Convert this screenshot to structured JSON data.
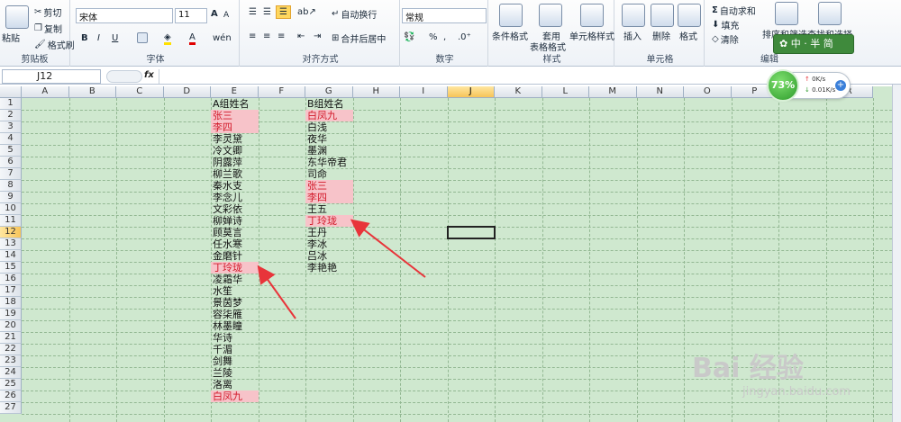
{
  "ribbon": {
    "clipboard": {
      "paste": "粘贴",
      "cut": "剪切",
      "copy": "复制",
      "format_painter": "格式刷",
      "label": "剪贴板"
    },
    "font": {
      "name": "宋体",
      "size": "11",
      "bold": "B",
      "italic": "I",
      "underline": "U",
      "grow": "A",
      "shrink": "A",
      "phonetic": "wén",
      "label": "字体"
    },
    "alignment": {
      "wrap": "自动换行",
      "merge": "合并后居中",
      "label": "对齐方式"
    },
    "number": {
      "format": "常规",
      "percent": "%",
      "comma": ",",
      "label": "数字"
    },
    "styles": {
      "conditional": "条件格式",
      "table_line1": "套用",
      "table_line2": "表格格式",
      "cell_styles": "单元格样式",
      "label": "样式"
    },
    "cells": {
      "insert": "插入",
      "delete": "删除",
      "format": "格式",
      "label": "单元格"
    },
    "editing": {
      "autosum": "自动求和",
      "fill": "填充",
      "clear": "清除",
      "sort": "排序和筛选",
      "find": "查找和选择",
      "label": "编辑"
    }
  },
  "formula_bar": {
    "name_box": "J12",
    "fx": "fx"
  },
  "widget": {
    "percent": "73%",
    "up": "0K/s",
    "down": "0.01K/s",
    "ime": "中 · 半 简"
  },
  "columns": [
    "A",
    "B",
    "C",
    "D",
    "E",
    "F",
    "G",
    "H",
    "I",
    "J",
    "K",
    "L",
    "M",
    "N",
    "O",
    "P",
    "Q",
    "R"
  ],
  "rows": [
    "1",
    "2",
    "3",
    "4",
    "5",
    "6",
    "7",
    "8",
    "9",
    "10",
    "11",
    "12",
    "13",
    "14",
    "15",
    "16",
    "17",
    "18",
    "19",
    "20",
    "21",
    "22",
    "23",
    "24",
    "25",
    "26",
    "27"
  ],
  "selected_column": "J",
  "selected_row": "12",
  "group_a": {
    "header": "A组姓名",
    "names": [
      "张三",
      "李四",
      "李灵黛",
      "冷文卿",
      "阴露萍",
      "柳兰歌",
      "秦水支",
      "李念儿",
      "文彩依",
      "柳婵诗",
      "顾莫言",
      "任水寒",
      "金磨针",
      "丁玲珑",
      "凌霜华",
      "水笙",
      "景茵梦",
      "容柒雁",
      "林墨瞳",
      "华诗",
      "千湄",
      "剑舞",
      "兰陵",
      "洛离",
      "白凤九"
    ],
    "highlighted": [
      0,
      1,
      13,
      24
    ]
  },
  "group_b": {
    "header": "B组姓名",
    "names": [
      "白凤九",
      "白浅",
      "夜华",
      "墨渊",
      "东华帝君",
      "司命",
      "张三",
      "李四",
      "王五",
      "丁玲珑",
      "王丹",
      "李冰",
      "吕冰",
      "李艳艳"
    ],
    "highlighted": [
      0,
      6,
      7,
      9
    ]
  },
  "watermark": {
    "brand": "Bai 经验",
    "url": "jingyan.baidu.com"
  },
  "colors": {
    "highlight_bg": "#f7c3c9",
    "highlight_text": "#d21a2a",
    "sheet_bg": "#cfe8cf",
    "arrow": "#e8343a"
  }
}
